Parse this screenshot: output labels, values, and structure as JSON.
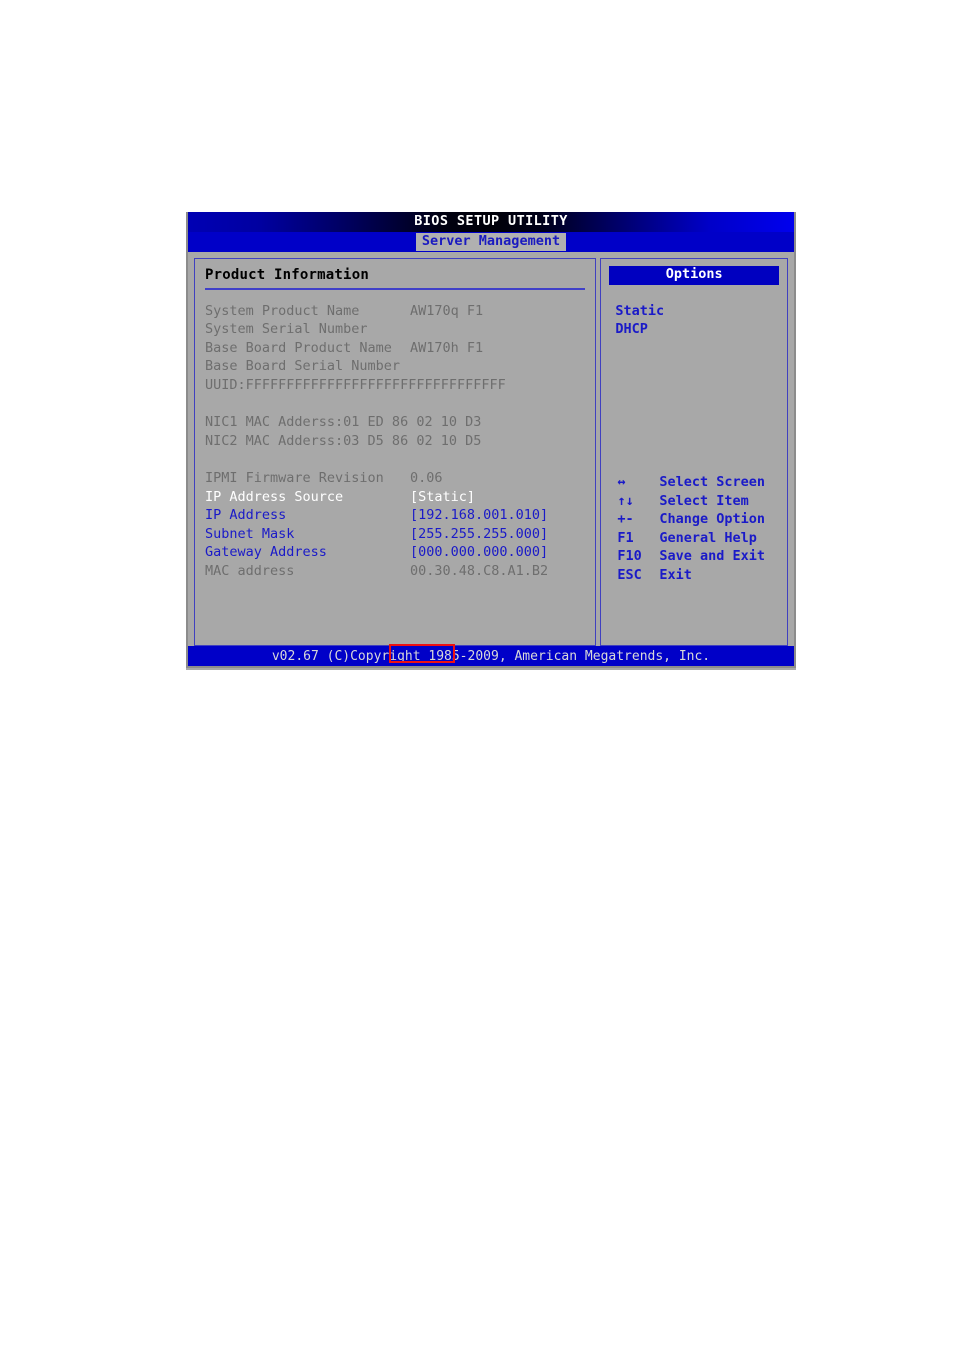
{
  "window": {
    "title": "BIOS SETUP UTILITY",
    "active_tab": "Server Management",
    "footer": "v02.67 (C)Copyright 1985-2009, American Megatrends, Inc."
  },
  "left_panel": {
    "section_title": "Product Information",
    "info_rows": [
      {
        "label": "System Product Name",
        "value": "AW170q F1"
      },
      {
        "label": "System Serial Number",
        "value": ""
      },
      {
        "label": "Base Board Product Name",
        "value": "AW170h F1"
      },
      {
        "label": "Base Board Serial Number",
        "value": ""
      }
    ],
    "uuid_line": "UUID:FFFFFFFFFFFFFFFFFFFFFFFFFFFFFFFF",
    "nic_lines": [
      "NIC1 MAC Adderss:01 ED 86 02 10 D3",
      "NIC2 MAC Adderss:03 D5 86 02 10 D5"
    ],
    "settings_rows": [
      {
        "label": "IPMI Firmware Revision",
        "value": "0.06",
        "style": "dim"
      },
      {
        "label": "IP Address Source",
        "value": "[Static]",
        "style": "selected"
      },
      {
        "label": "IP Address",
        "value": "[192.168.001.010]",
        "style": "blue"
      },
      {
        "label": "Subnet Mask",
        "value": "[255.255.255.000]",
        "style": "blue"
      },
      {
        "label": "Gateway Address",
        "value": "[000.000.000.000]",
        "style": "blue"
      },
      {
        "label": "MAC address",
        "value": "00.30.48.C8.A1.B2",
        "style": "dim"
      }
    ]
  },
  "right_panel": {
    "options_header": "Options",
    "options": [
      "Static",
      "DHCP"
    ],
    "nav_help": [
      {
        "key": "↔",
        "action": "Select Screen"
      },
      {
        "key": "↑↓",
        "action": "Select Item"
      },
      {
        "key": "+-",
        "action": "Change Option"
      },
      {
        "key": "F1",
        "action": "General Help"
      },
      {
        "key": "F10",
        "action": "Save and Exit"
      },
      {
        "key": "ESC",
        "action": "Exit"
      }
    ]
  },
  "annotation": {
    "target_text": "NIC2 MAC",
    "color": "#ee1111"
  }
}
